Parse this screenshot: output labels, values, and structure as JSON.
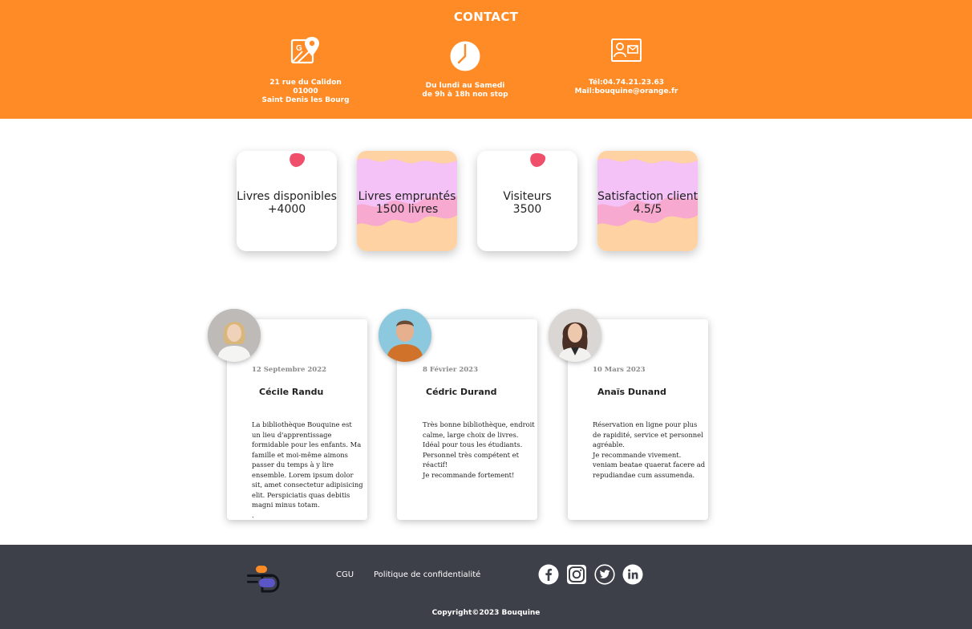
{
  "contact": {
    "title": "CONTACT",
    "address": {
      "icon": "map-pin-icon",
      "lines": [
        "21 rue du Calidon",
        "01000",
        "Saint Denis les Bourg"
      ]
    },
    "hours": {
      "icon": "clock-icon",
      "lines": [
        "Du lundi au Samedi",
        "de 9h à 18h non stop"
      ]
    },
    "phone": {
      "icon": "contact-card-icon",
      "lines": [
        "Tél:04.74.21.23.63",
        "Mail:bouquine@orange.fr"
      ]
    }
  },
  "stats": [
    {
      "label": "Livres disponibles",
      "value": "+4000"
    },
    {
      "label": "Livres empruntés",
      "value": "1500 livres"
    },
    {
      "label": "Visiteurs",
      "value": "3500"
    },
    {
      "label": "Satisfaction client",
      "value": "4.5/5"
    }
  ],
  "testimonials": [
    {
      "date": "12 Septembre 2022",
      "name": "Cécile Randu",
      "lines": [
        "La bibliothèque Bouquine est",
        "un lieu d'apprentissage",
        "formidable pour les enfants. Ma",
        "famille et moi-même aimons",
        "passer du temps à y lire",
        "ensemble. Lorem ipsum dolor",
        "sit, amet consectetur adipisicing",
        "elit. Perspiciatis quas debitis",
        "magni minus totam.",
        "."
      ]
    },
    {
      "date": "8 Février 2023",
      "name": "Cédric Durand",
      "lines": [
        "Très bonne bibliothèque, endroit",
        "calme, large choix de livres.",
        "Idéal pour tous les étudiants.",
        "Personnel très compétent et",
        "réactif!",
        "Je recommande fortement!"
      ]
    },
    {
      "date": "10 Mars 2023",
      "name": "Anaïs Dunand",
      "lines": [
        "Réservation en ligne pour plus",
        "de rapidité, service et personnel",
        "agréable.",
        "Je recommande vivement.",
        "veniam beatae quaerat facere ad",
        "repudiandae cum assumenda."
      ]
    }
  ],
  "footer": {
    "logo": "bouquine-logo",
    "links": [
      "CGU",
      "Politique de confidentialité"
    ],
    "social": [
      "facebook-icon",
      "instagram-icon",
      "twitter-icon",
      "linkedin-icon"
    ],
    "copyright": "Copyright©2023 Bouquine"
  },
  "colors": {
    "orange": "#ff8b26",
    "footer_bg": "#3d4048",
    "pink": "#f4c2f7",
    "peach": "#ffd2a3",
    "rose": "#f7a9cf",
    "blob": "#ef4f6a"
  }
}
